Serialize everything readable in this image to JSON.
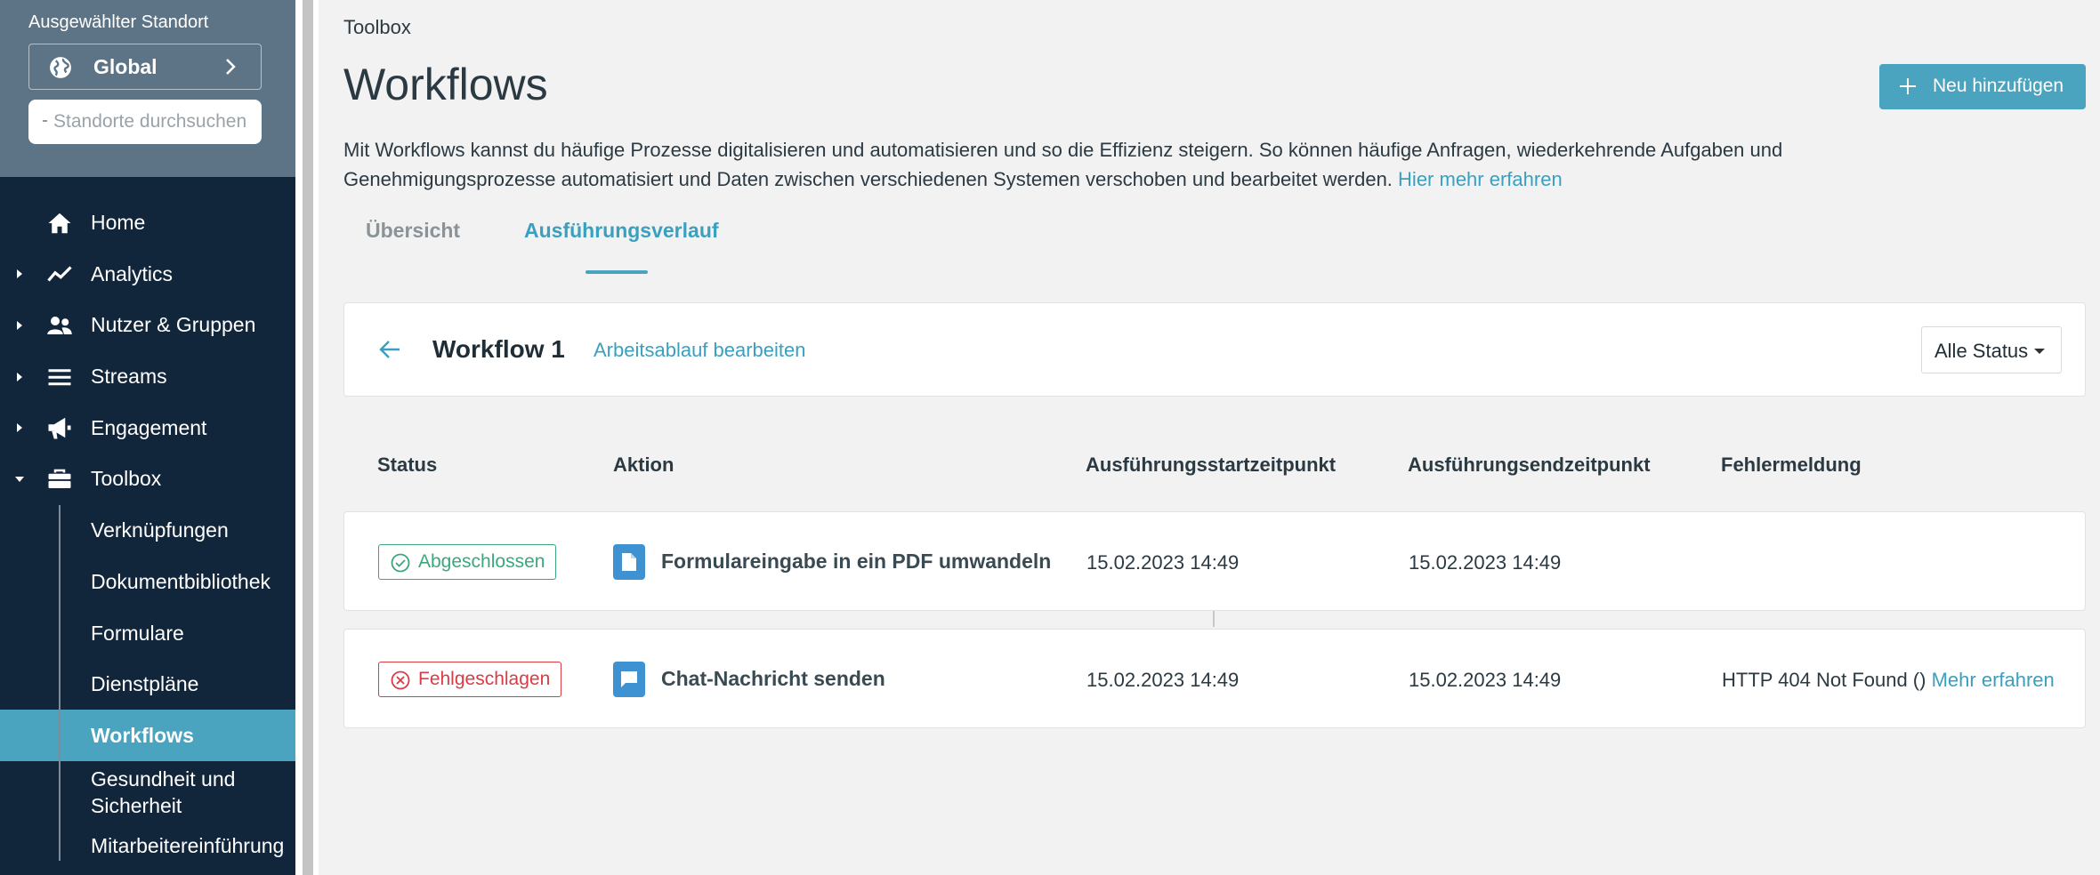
{
  "sidebar": {
    "location_caption": "Ausgewählter Standort",
    "location_value": "Global",
    "search_placeholder": "Standorte durchsuchen",
    "nav": [
      {
        "label": "Home",
        "icon": "home-icon"
      },
      {
        "label": "Analytics",
        "icon": "analytics-icon"
      },
      {
        "label": "Nutzer & Gruppen",
        "icon": "users-icon"
      },
      {
        "label": "Streams",
        "icon": "streams-icon"
      },
      {
        "label": "Engagement",
        "icon": "megaphone-icon"
      },
      {
        "label": "Toolbox",
        "icon": "toolbox-icon"
      }
    ],
    "toolbox_items": [
      {
        "label": "Verknüpfungen"
      },
      {
        "label": "Dokumentbibliothek"
      },
      {
        "label": "Formulare"
      },
      {
        "label": "Dienstpläne"
      },
      {
        "label": "Workflows",
        "active": true
      },
      {
        "label": "Gesundheit und Sicherheit"
      },
      {
        "label": "Mitarbeitereinführung"
      }
    ]
  },
  "header": {
    "breadcrumb": "Toolbox",
    "title": "Workflows",
    "add_button": "Neu hinzufügen",
    "description": "Mit Workflows kannst du häufige Prozesse digitalisieren und automatisieren und so die Effizienz steigern. So können häufige Anfragen, wiederkehrende Aufgaben und Genehmigungsprozesse automatisiert und Daten zwischen verschiedenen Systemen verschoben und bearbeitet werden.",
    "learn_more": "Hier mehr erfahren"
  },
  "tabs": [
    {
      "label": "Übersicht",
      "active": false
    },
    {
      "label": "Ausführungsverlauf",
      "active": true
    }
  ],
  "workflow": {
    "name": "Workflow 1",
    "edit_link": "Arbeitsablauf bearbeiten",
    "status_filter": "Alle Status"
  },
  "table": {
    "headers": [
      "Status",
      "Aktion",
      "Ausführungsstartzeitpunkt",
      "Ausführungsendzeitpunkt",
      "Fehlermeldung"
    ],
    "rows": [
      {
        "status": "Abgeschlossen",
        "status_type": "success",
        "action": "Formulareingabe in ein PDF umwandeln",
        "action_icon": "document-icon",
        "start": "15.02.2023 14:49",
        "end": "15.02.2023 14:49",
        "error": "",
        "error_link": ""
      },
      {
        "status": "Fehlgeschlagen",
        "status_type": "error",
        "action": "Chat-Nachricht senden",
        "action_icon": "chat-icon",
        "start": "15.02.2023 14:49",
        "end": "15.02.2023 14:49",
        "error": "HTTP 404 Not Found ()",
        "error_link": "Mehr erfahren"
      }
    ]
  },
  "colors": {
    "accent": "#4aa3bf",
    "sidebar_bg": "#12263b",
    "success": "#3aa87a",
    "error": "#d93c44"
  }
}
